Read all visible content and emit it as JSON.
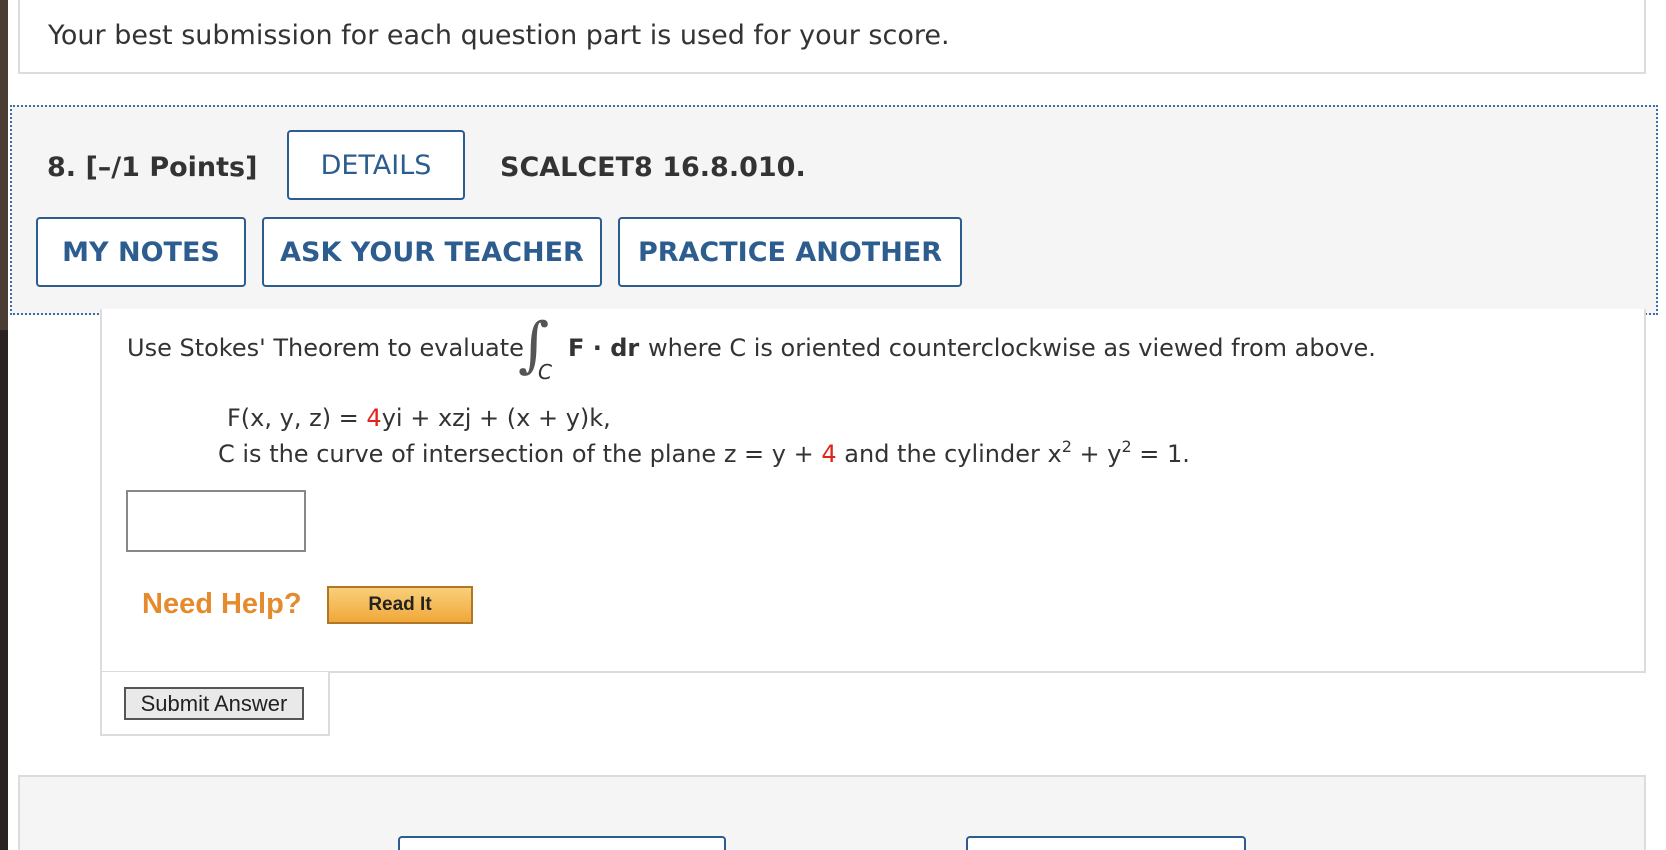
{
  "banner": {
    "message": "Your best submission for each question part is used for your score."
  },
  "question": {
    "number": "8.",
    "points": "[–/1 Points]",
    "details_label": "DETAILS",
    "code": "SCALCET8 16.8.010.",
    "my_notes_label": "MY NOTES",
    "ask_teacher_label": "ASK YOUR TEACHER",
    "practice_label": "PRACTICE ANOTHER"
  },
  "problem": {
    "prompt_before": "Use Stokes' Theorem to evaluate",
    "integral_symbol": "∫",
    "integral_subscript": "C",
    "integrand": "F · dr",
    "prompt_after": "where C is oriented counterclockwise as viewed from above.",
    "field_lhs": "F(x, y, z) = ",
    "field_coeff": "4",
    "field_rest": "yi + xzj + (x + y)k,",
    "curve_text_1": "C is the curve of intersection of the plane  z = y + ",
    "curve_const": "4",
    "curve_text_2": "  and the cylinder  x",
    "curve_text_3": " + y",
    "curve_text_4": " = 1.",
    "exponent": "2"
  },
  "answer": {
    "value": ""
  },
  "help": {
    "need_help_label": "Need Help?",
    "read_it_label": "Read It"
  },
  "submit": {
    "label": "Submit Answer"
  },
  "colors": {
    "accent": "#2d5d8f",
    "highlight_red": "#e0241b",
    "need_help_orange": "#e58a2d"
  }
}
